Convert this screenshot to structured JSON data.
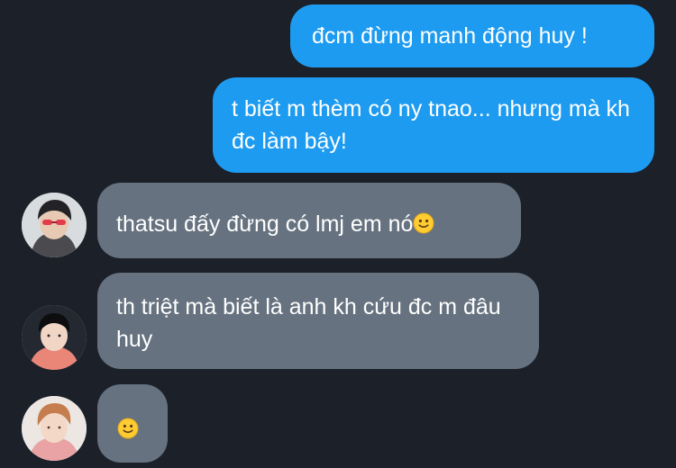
{
  "messages": [
    {
      "direction": "outgoing",
      "text": "đcm đừng manh động huy !"
    },
    {
      "direction": "outgoing",
      "text": "t biết m thèm có ny tnao... nhưng mà kh đc làm bậy!"
    },
    {
      "direction": "incoming",
      "avatar": "avatar-icon",
      "text": "thatsu đấy đừng có lmj em nó",
      "emoji": "slightly-smiling-face-icon"
    },
    {
      "direction": "incoming",
      "avatar": "avatar-icon",
      "text": "th triệt mà biết là anh kh cứu đc m đâu huy"
    },
    {
      "direction": "incoming",
      "avatar": "avatar-icon",
      "text": "",
      "emoji": "slightly-smiling-face-icon"
    }
  ],
  "colors": {
    "background": "#1b2029",
    "outgoing_bubble": "#1d9bf0",
    "incoming_bubble": "#66727f",
    "text": "#ffffff"
  }
}
